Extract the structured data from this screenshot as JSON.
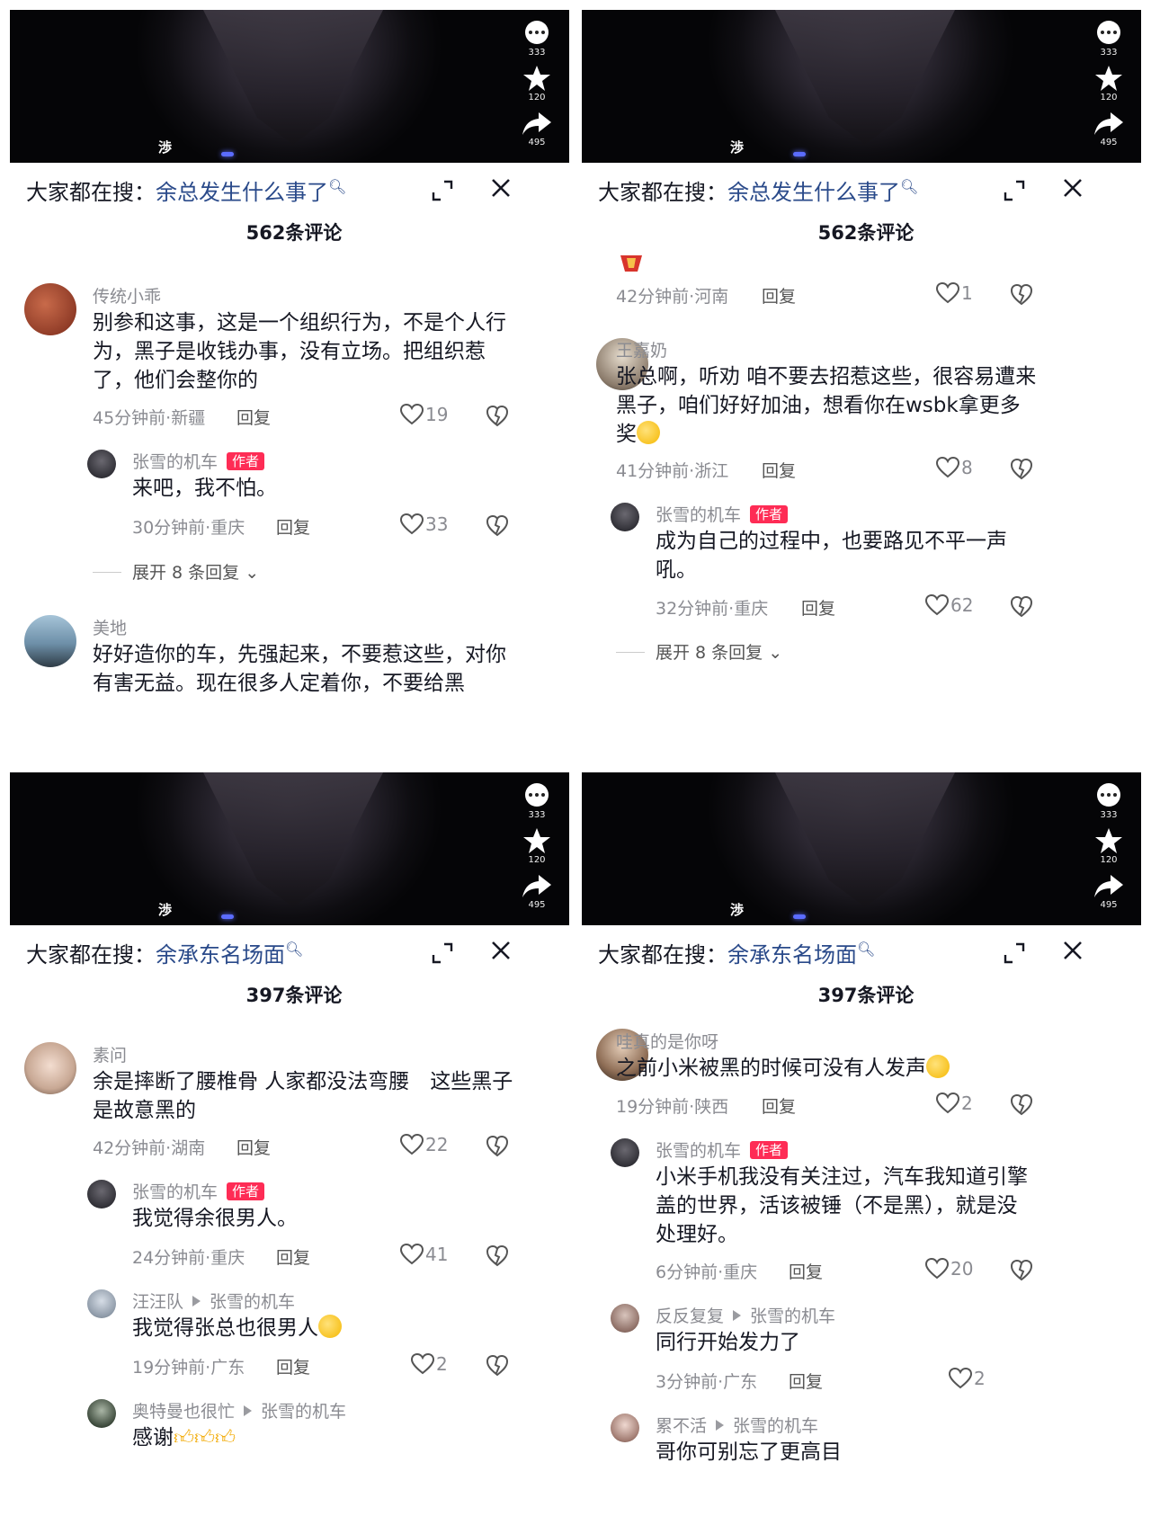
{
  "video_overlay": {
    "brand": "渉",
    "comment_count": "333",
    "favorite_count": "120",
    "share_count": "495"
  },
  "panels": [
    {
      "search_prefix": "大家都在搜：",
      "search_term": "余总发生什么事了",
      "comment_count": "562条评论",
      "c0": {
        "user": "传统小乖",
        "text": "别参和这事，这是一个组织行为，不是个人行为，黑子是收钱办事，没有立场。把组织惹了，他们会整你的",
        "meta": "45分钟前·新疆",
        "reply": "回复",
        "likes": "19"
      },
      "c1": {
        "user": "张雪的机车",
        "badge": "作者",
        "text": "来吧，我不怕。",
        "meta": "30分钟前·重庆",
        "reply": "回复",
        "likes": "33"
      },
      "expand": "展开 8 条回复",
      "c2": {
        "user": "美地",
        "text": "好好造你的车，先强起来，不要惹这些，对你有害无益。现在很多人定着你，不要给黑"
      }
    },
    {
      "search_prefix": "大家都在搜：",
      "search_term": "余总发生什么事了",
      "comment_count": "562条评论",
      "c0": {
        "meta": "42分钟前·河南",
        "reply": "回复",
        "likes": "1"
      },
      "c1": {
        "user": "王嘉奶",
        "text": "张总啊，听劝 咱不要去招惹这些，很容易遭来黑子，咱们好好加油，想看你在wsbk拿更多奖",
        "meta": "41分钟前·浙江",
        "reply": "回复",
        "likes": "8"
      },
      "c2": {
        "user": "张雪的机车",
        "badge": "作者",
        "text": "成为自己的过程中，也要路见不平一声吼。",
        "meta": "32分钟前·重庆",
        "reply": "回复",
        "likes": "62"
      },
      "expand": "展开 8 条回复"
    },
    {
      "search_prefix": "大家都在搜：",
      "search_term": "余承东名场面",
      "comment_count": "397条评论",
      "c0": {
        "user": "素问",
        "text": "余是摔断了腰椎骨 人家都没法弯腰　这些黑子是故意黑的",
        "meta": "42分钟前·湖南",
        "reply": "回复",
        "likes": "22"
      },
      "c1": {
        "user": "张雪的机车",
        "badge": "作者",
        "text": "我觉得余很男人。",
        "meta": "24分钟前·重庆",
        "reply": "回复",
        "likes": "41"
      },
      "c2": {
        "user": "汪汪队",
        "reply_to": "张雪的机车",
        "text": "我觉得张总也很男人",
        "meta": "19分钟前·广东",
        "reply": "回复",
        "likes": "2"
      },
      "c3": {
        "user": "奥特曼也很忙",
        "reply_to": "张雪的机车",
        "text": "感谢"
      }
    },
    {
      "search_prefix": "大家都在搜：",
      "search_term": "余承东名场面",
      "comment_count": "397条评论",
      "c0": {
        "user": "哇真的是你呀",
        "text": "之前小米被黑的时候可没有人发声",
        "meta": "19分钟前·陕西",
        "reply": "回复",
        "likes": "2"
      },
      "c1": {
        "user": "张雪的机车",
        "badge": "作者",
        "text": "小米手机我没有关注过，汽车我知道引擎盖的世界，活该被锤（不是黑），就是没处理好。",
        "meta": "6分钟前·重庆",
        "reply": "回复",
        "likes": "20"
      },
      "c2": {
        "user": "反反复复",
        "reply_to": "张雪的机车",
        "text": "同行开始发力了",
        "meta": "3分钟前·广东",
        "reply": "回复",
        "likes": "2"
      },
      "c3": {
        "user": "累不活",
        "reply_to": "张雪的机车",
        "text": "哥你可别忘了更高目"
      }
    }
  ],
  "colors": {
    "accent": "#fe2c55",
    "link": "#2a4a8a",
    "muted": "#8a8b91"
  },
  "icons": [
    "comment-icon",
    "star-icon",
    "share-icon",
    "expand-icon",
    "close-icon",
    "heart-icon",
    "dislike-icon",
    "fu-badge-icon",
    "chevron-down-icon"
  ]
}
